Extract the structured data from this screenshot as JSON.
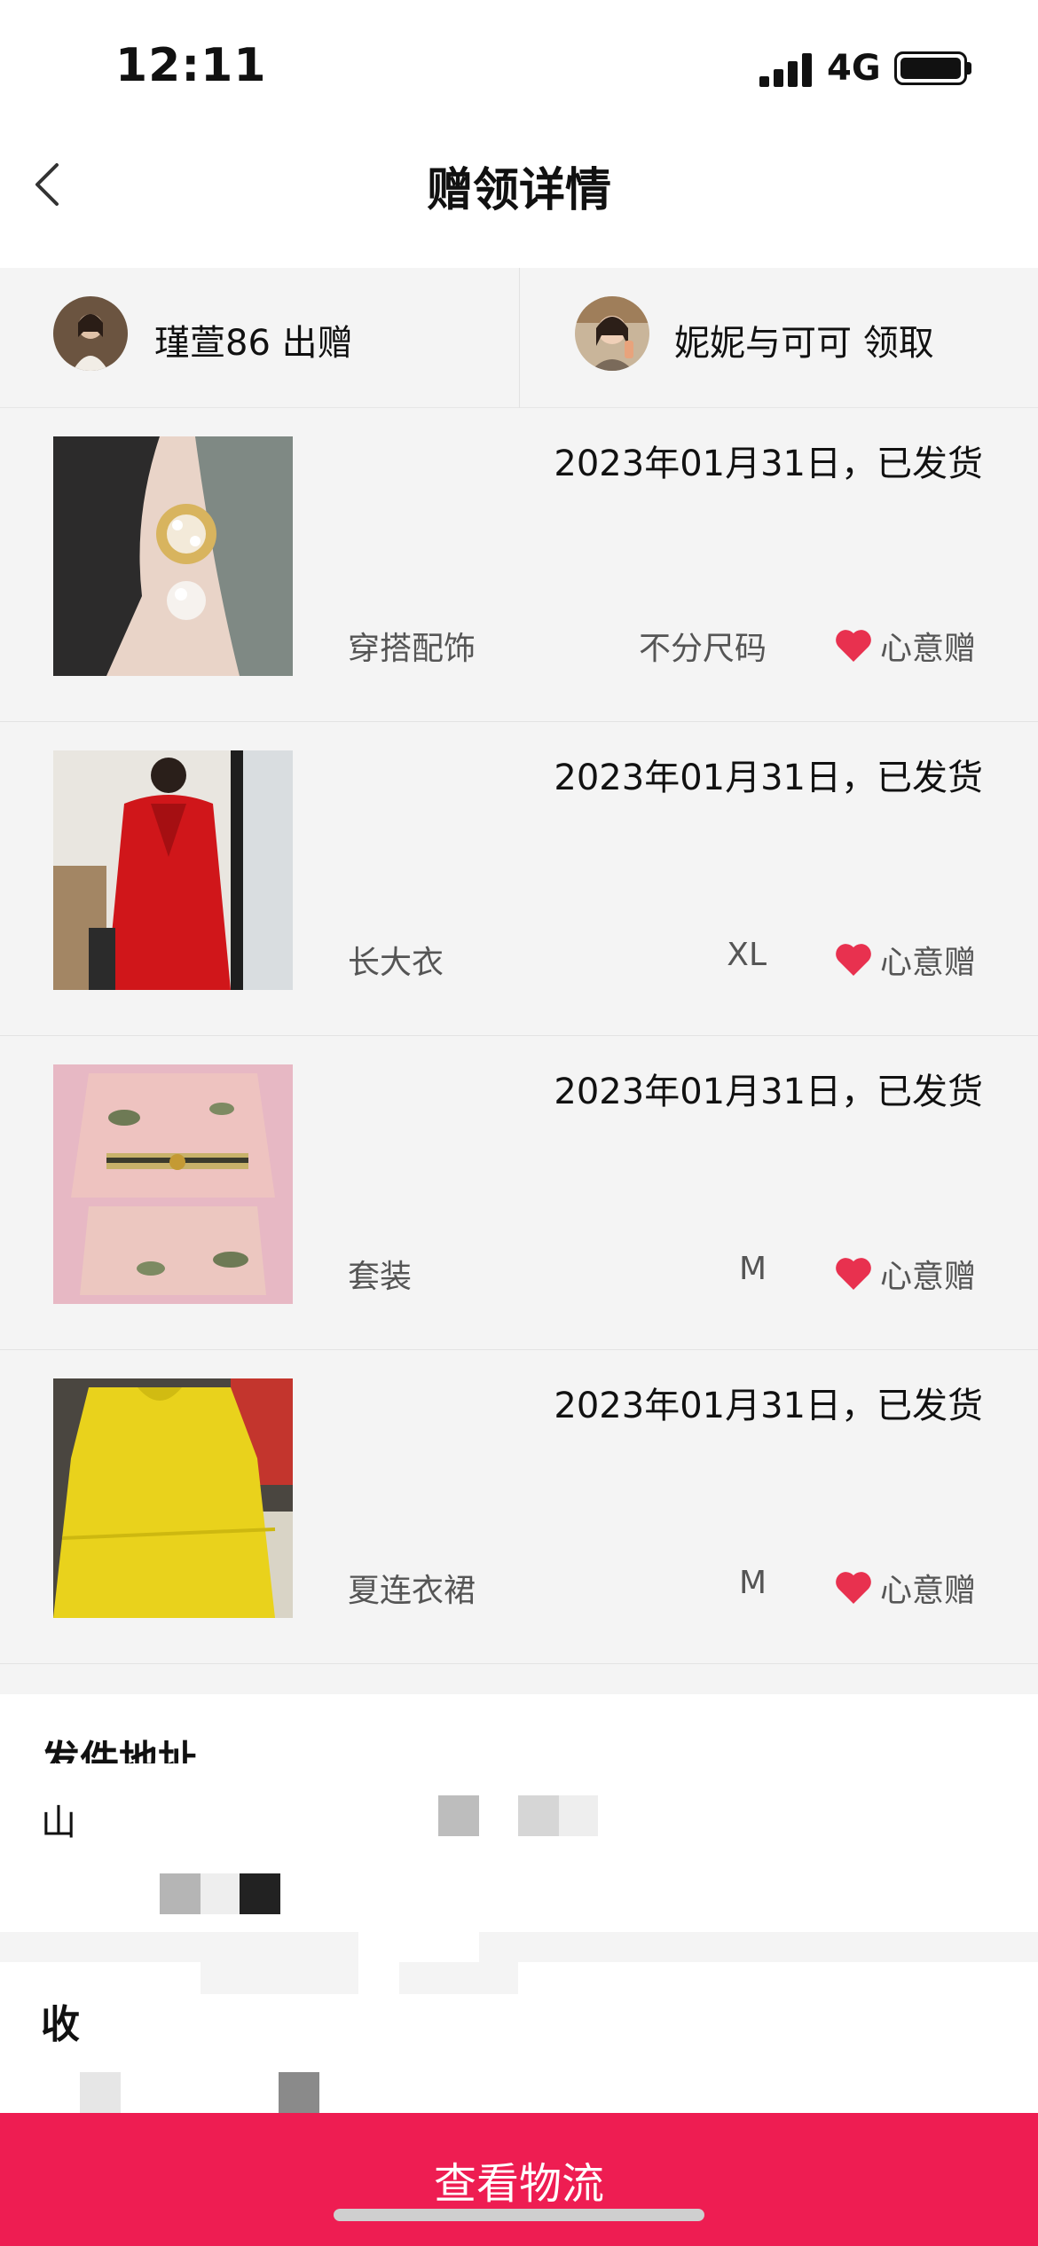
{
  "status_bar": {
    "time": "12:11",
    "network": "4G"
  },
  "nav": {
    "title": "赠领详情"
  },
  "users": {
    "giver": {
      "label": "瑾萱86 出赠"
    },
    "receiver": {
      "label": "妮妮与可可 领取"
    }
  },
  "items": [
    {
      "date_status": "2023年01月31日，已发货",
      "category": "穿搭配饰",
      "size": "不分尺码",
      "gift_type": "心意赠"
    },
    {
      "date_status": "2023年01月31日，已发货",
      "category": "长大衣",
      "size": "XL",
      "gift_type": "心意赠"
    },
    {
      "date_status": "2023年01月31日，已发货",
      "category": "套装",
      "size": "M",
      "gift_type": "心意赠"
    },
    {
      "date_status": "2023年01月31日，已发货",
      "category": "夏连衣裙",
      "size": "M",
      "gift_type": "心意赠"
    }
  ],
  "sender_address": {
    "title": "发件地址",
    "line1": "山"
  },
  "receiver_address": {
    "title": "收"
  },
  "cta": {
    "label": "查看物流"
  },
  "colors": {
    "accent": "#ee1d52",
    "heart": "#e8314f",
    "background": "#f4f4f4"
  }
}
